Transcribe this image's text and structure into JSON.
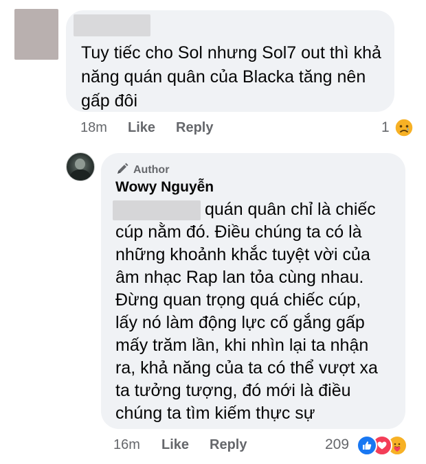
{
  "comment1": {
    "text": "Tuy tiếc cho Sol nhưng Sol7 out thì khả năng quán quân của Blacka tăng nên gấp đôi",
    "time": "18m",
    "like_label": "Like",
    "reply_label": "Reply",
    "reaction_count": "1",
    "reaction_icon": "sad-icon"
  },
  "reply": {
    "author_badge": "Author",
    "author_name": "Wowy Nguyễn",
    "text": "quán quân chỉ là chiếc\ncúp nằm đó. Điều chúng ta có là\nnhững khoảnh khắc tuyệt vời của\nâm nhạc Rap lan tỏa cùng nhau.\nĐừng quan trọng quá chiếc cúp,\nlấy nó làm động lực cố gắng gấp\nmấy trăm lần, khi nhìn lại ta nhận\nra, khả năng của ta có thể vượt xa\nta tưởng tượng, đó mới là điều\nchúng ta tìm kiếm thực sự",
    "time": "16m",
    "like_label": "Like",
    "reply_label": "Reply",
    "reaction_count": "209",
    "reaction_icons": [
      "like-icon",
      "love-icon",
      "care-icon"
    ]
  },
  "colors": {
    "bubble": "#f0f2f5",
    "meta_text": "#65676b",
    "like_blue": "#1877f2",
    "love_red": "#f33e58",
    "emoji_yellow": "#f7b125"
  }
}
